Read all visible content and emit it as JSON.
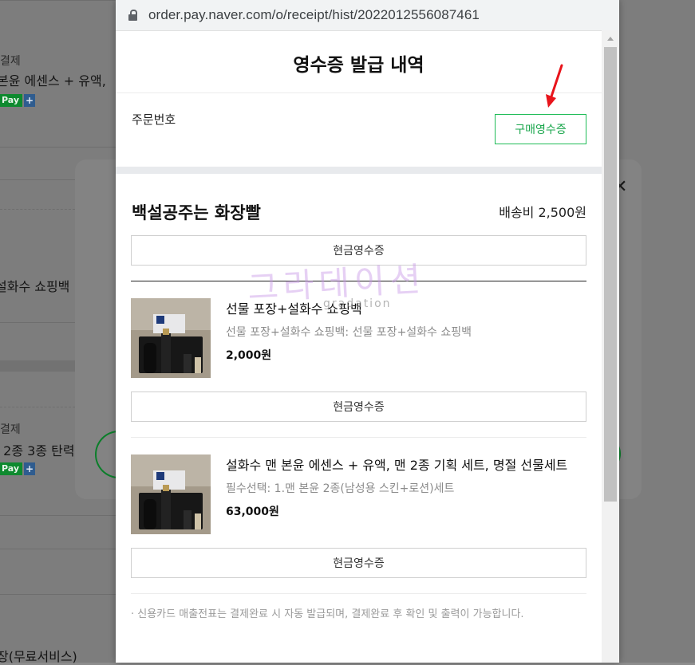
{
  "browser": {
    "url": "order.pay.naver.com/o/receipt/hist/2022012556087461"
  },
  "background": {
    "label_payment_1": "결제",
    "product_1": "본윤 에센스 + 유액,",
    "pay_badge": "Pay",
    "pay_plus": "+",
    "product_2": "설화수 쇼핑백",
    "label_payment_2": "결제",
    "product_3": "· 2종 3종 탄력",
    "product_4": "장(무료서비스)",
    "close_symbol": "✕"
  },
  "popup": {
    "title": "영수증 발급 내역",
    "order_number_label": "주문번호",
    "purchase_receipt_button": "구매영수증",
    "store": {
      "name": "백설공주는 화장빨",
      "shipping_fee": "배송비 2,500원",
      "cash_receipt_button": "현금영수증"
    },
    "items": [
      {
        "name": "선물 포장+설화수 쇼핑백",
        "option": "선물 포장+설화수 쇼핑백: 선물 포장+설화수 쇼핑백",
        "price": "2,000원",
        "cash_receipt_button": "현금영수증"
      },
      {
        "name": "설화수 맨 본윤 에센스 + 유액, 맨 2종 기획 세트, 명절 선물세트",
        "option": "필수선택: 1.맨 본윤 2종(남성용 스킨+로션)세트",
        "price": "63,000원",
        "cash_receipt_button": "현금영수증"
      }
    ],
    "notice": "· 신용카드 매출전표는 결제완료 시 자동 발급되며, 결제완료 후 확인 및 출력이 가능합니다."
  },
  "watermark": {
    "text": "그라데이션",
    "sub": "gradation"
  },
  "colors": {
    "accent_green": "#1fbc57",
    "arrow_red": "#e8141b",
    "naver_pay_green": "#0e8a2f"
  }
}
